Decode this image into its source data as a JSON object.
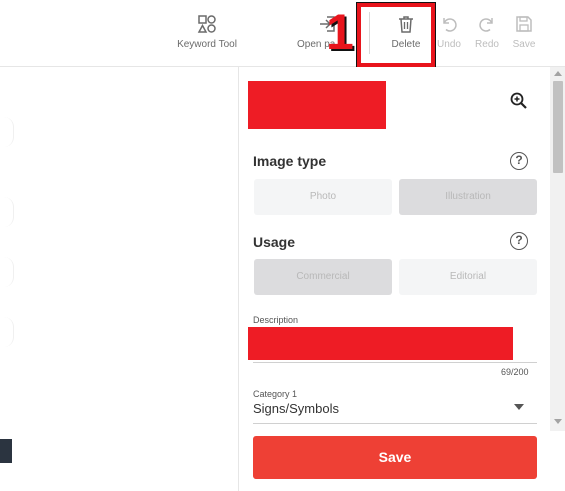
{
  "toolbar": {
    "keyword_tool": "Keyword Tool",
    "open_panel": "Open pa",
    "delete": "Delete",
    "undo": "Undo",
    "redo": "Redo",
    "save": "Save"
  },
  "annotation": {
    "number": "1",
    "color": "#e8141c"
  },
  "panel": {
    "image_type": {
      "title": "Image type",
      "help": "?",
      "options": [
        "Photo",
        "Illustration"
      ],
      "selected": "Illustration"
    },
    "usage": {
      "title": "Usage",
      "help": "?",
      "options": [
        "Commercial",
        "Editorial"
      ],
      "selected": "Commercial"
    },
    "description": {
      "label": "Description",
      "counter": "69/200"
    },
    "category": {
      "label": "Category 1",
      "value": "Signs/Symbols"
    },
    "save_button": "Save"
  },
  "colors": {
    "accent": "#ee4035",
    "redaction": "#ee1c25"
  }
}
